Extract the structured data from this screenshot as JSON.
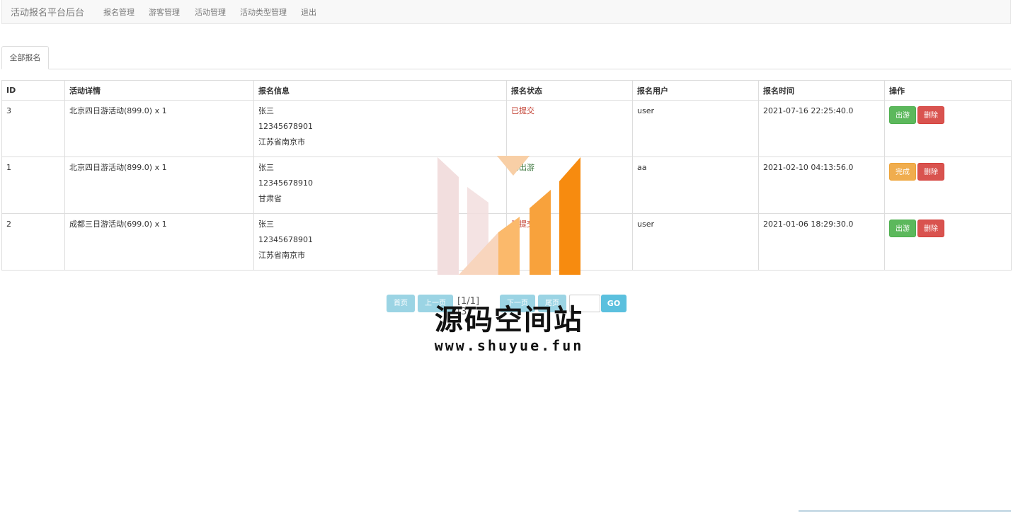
{
  "navbar": {
    "brand": "活动报名平台后台",
    "items": [
      "报名管理",
      "游客管理",
      "活动管理",
      "活动类型管理",
      "退出"
    ]
  },
  "tabs": [
    {
      "label": "全部报名"
    }
  ],
  "table": {
    "headers": [
      "ID",
      "活动详情",
      "报名信息",
      "报名状态",
      "报名用户",
      "报名时间",
      "操作"
    ],
    "rows": [
      {
        "id": "3",
        "activity": "北京四日游活动(899.0) x 1",
        "info": [
          "张三",
          "12345678901",
          "江苏省南京市"
        ],
        "status": "已提交",
        "user": "user",
        "time": "2021-07-16 22:25:40.0",
        "actions": [
          "出游",
          "删除"
        ]
      },
      {
        "id": "1",
        "activity": "北京四日游活动(899.0) x 1",
        "info": [
          "张三",
          "12345678910",
          "甘肃省"
        ],
        "status": "已出游",
        "user": "aa",
        "time": "2021-02-10 04:13:56.0",
        "actions": [
          "完成",
          "删除"
        ]
      },
      {
        "id": "2",
        "activity": "成都三日游活动(699.0) x 1",
        "info": [
          "张三",
          "12345678901",
          "江苏省南京市"
        ],
        "status": "已提交",
        "user": "user",
        "time": "2021-01-06 18:29:30.0",
        "actions": [
          "出游",
          "删除"
        ]
      }
    ]
  },
  "pager": {
    "first": "首页",
    "prev": "上一页",
    "info": "[1/1][3]",
    "next": "下一页",
    "last": "尾页",
    "go": "GO"
  },
  "watermark": {
    "title": "源码空间站",
    "url": "www.shuyue.fun"
  },
  "colors": {
    "success": "#5cb85c",
    "danger": "#d9534f",
    "warning": "#f0ad4e",
    "info": "#5bc0de",
    "logo_orange": "#f78b0f"
  }
}
